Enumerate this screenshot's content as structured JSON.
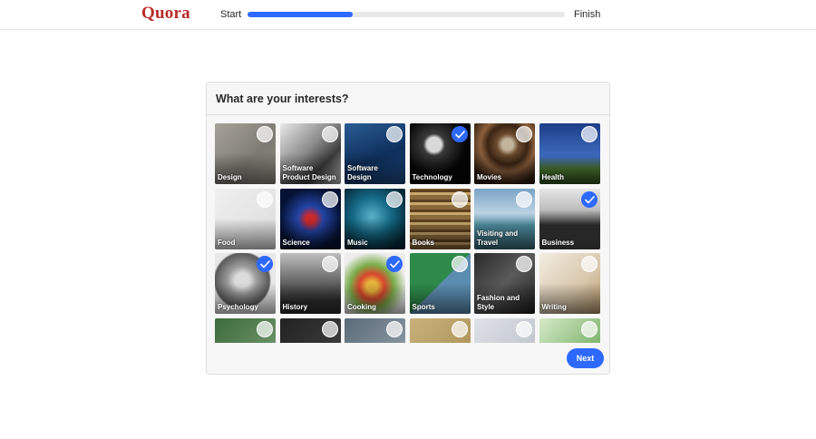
{
  "header": {
    "logo": "Quora",
    "start_label": "Start",
    "finish_label": "Finish",
    "progress": 0.33,
    "accent_color": "#2e69ff",
    "brand_color": "#b92b27"
  },
  "modal": {
    "title": "What are your interests?",
    "next_label": "Next",
    "topics": [
      {
        "label": "Design",
        "selected": false,
        "bg": "linear-gradient(135deg,#a8a49a,#7d7a72 60%,#8e8a80)"
      },
      {
        "label": "Software Product Design",
        "selected": false,
        "bg": "linear-gradient(135deg,#e9e9e9,#8a8a8a 45%,#3a3a3a 70%,#cfcfcf)"
      },
      {
        "label": "Software Design",
        "selected": false,
        "bg": "linear-gradient(160deg,#2a5d93,#0e2f5c 55%,#1c4d87)"
      },
      {
        "label": "Technology",
        "selected": true,
        "bg": "radial-gradient(circle at 40% 35%,#d9d9d9 0 8px,#3a3a3a 12px,#050505 34px)"
      },
      {
        "label": "Movies",
        "selected": false,
        "bg": "radial-gradient(circle at 55% 35%,#c4b49c 0 6px,#6b4a2c 12px,#3b2414 22px,#8a5f3c 30px,#2c1b0f 45px)"
      },
      {
        "label": "Health",
        "selected": false,
        "bg": "linear-gradient(to bottom,#1d3d87,#3f6cc0 55%,#4e7a34 75%,#2f5521)"
      },
      {
        "label": "Food",
        "selected": false,
        "bg": "linear-gradient(135deg,#f0f0f0,#dcdcdc)"
      },
      {
        "label": "Science",
        "selected": false,
        "bg": "radial-gradient(circle at 50% 50%,#c9282d 0 5px,#2244a5 14px,#061233 34px)"
      },
      {
        "label": "Music",
        "selected": false,
        "bg": "radial-gradient(circle at 45% 45%,#5bb0c9,#146985 40%,#062a3a 80%)"
      },
      {
        "label": "Books",
        "selected": false,
        "bg": "repeating-linear-gradient(0deg,#8a6a3a 0 5px,#c9a86c 5px 8px,#5e4120 8px 11px)"
      },
      {
        "label": "Visiting and Travel",
        "selected": false,
        "bg": "linear-gradient(to bottom,#7aa4c8,#bcd2e2 40%,#4f8fa1 60%,#3b6c7a)"
      },
      {
        "label": "Business",
        "selected": true,
        "bg": "linear-gradient(to bottom,#e6e6e6,#bdbdbd 35%,#2a2a2a 60%,#4a4a4a)"
      },
      {
        "label": "Psychology",
        "selected": true,
        "bg": "radial-gradient(circle at 45% 45%,#dcdcdc 0 8px,#9b9b9b 16px,#5a5a5a 30px,#e8e8e8 32px)"
      },
      {
        "label": "History",
        "selected": false,
        "bg": "linear-gradient(to bottom,#bfbfbf,#6a6a6a 45%,#2d2d2d 80%)"
      },
      {
        "label": "Cooking",
        "selected": true,
        "bg": "radial-gradient(circle at 45% 55%,#e6b33a 0 6px,#d9442c 14px,#7cae4a 24px,#ededed 38px)"
      },
      {
        "label": "Sports",
        "selected": false,
        "bg": "linear-gradient(135deg,#2e8a4a 0 50%,#5b8db0 50% 100%)"
      },
      {
        "label": "Fashion and Style",
        "selected": false,
        "bg": "linear-gradient(135deg,#2a2a2a,#5a5a5a 50%,#1c1c1c)"
      },
      {
        "label": "Writing",
        "selected": false,
        "bg": "linear-gradient(135deg,#f3ede2,#d8c7ab 60%,#b6976a)"
      },
      {
        "label": "",
        "selected": false,
        "bg": "linear-gradient(135deg,#3c6b3c,#7ea07a)"
      },
      {
        "label": "",
        "selected": false,
        "bg": "linear-gradient(135deg,#222222,#444444)"
      },
      {
        "label": "",
        "selected": false,
        "bg": "linear-gradient(135deg,#5a6b78,#9aa6b0)"
      },
      {
        "label": "",
        "selected": false,
        "bg": "linear-gradient(135deg,#c9b27a,#a68b52)"
      },
      {
        "label": "",
        "selected": false,
        "bg": "linear-gradient(135deg,#dfe3e8,#b6bcc4)"
      },
      {
        "label": "",
        "selected": false,
        "bg": "linear-gradient(135deg,#d7e9c8,#5aa04a)"
      }
    ]
  }
}
